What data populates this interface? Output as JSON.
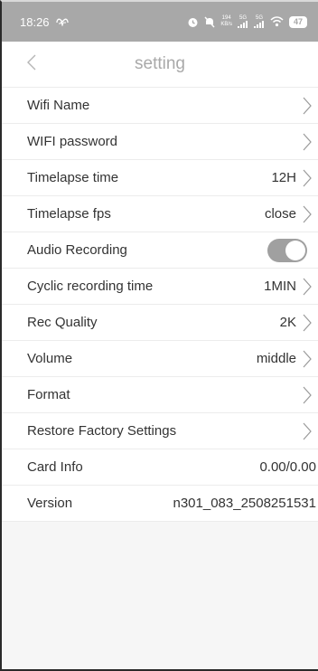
{
  "status_bar": {
    "time": "18:26",
    "net_speed_value": "194",
    "net_speed_unit": "KB/s",
    "signal_1_label": "5G",
    "signal_2_label": "5G",
    "battery": "47"
  },
  "header": {
    "title": "setting",
    "back_icon": "chevron-left-icon"
  },
  "settings": [
    {
      "label": "Wifi Name",
      "value": "",
      "control": "chevron"
    },
    {
      "label": "WIFI password",
      "value": "",
      "control": "chevron"
    },
    {
      "label": "Timelapse time",
      "value": "12H",
      "control": "chevron"
    },
    {
      "label": "Timelapse fps",
      "value": "close",
      "control": "chevron"
    },
    {
      "label": "Audio Recording",
      "value": "",
      "control": "toggle",
      "toggle_on": true
    },
    {
      "label": "Cyclic recording time",
      "value": "1MIN",
      "control": "chevron"
    },
    {
      "label": "Rec Quality",
      "value": "2K",
      "control": "chevron"
    },
    {
      "label": "Volume",
      "value": "middle",
      "control": "chevron"
    },
    {
      "label": "Format",
      "value": "",
      "control": "chevron"
    },
    {
      "label": "Restore Factory Settings",
      "value": "",
      "control": "chevron"
    },
    {
      "label": "Card Info",
      "value": "0.00/0.00",
      "control": "none"
    },
    {
      "label": "Version",
      "value": "n301_083_2508251531",
      "control": "none"
    }
  ],
  "colors": {
    "status_bar_bg": "#a8a8a8",
    "toggle_bg": "#a0a0a0",
    "title_color": "#a9a9a9"
  }
}
